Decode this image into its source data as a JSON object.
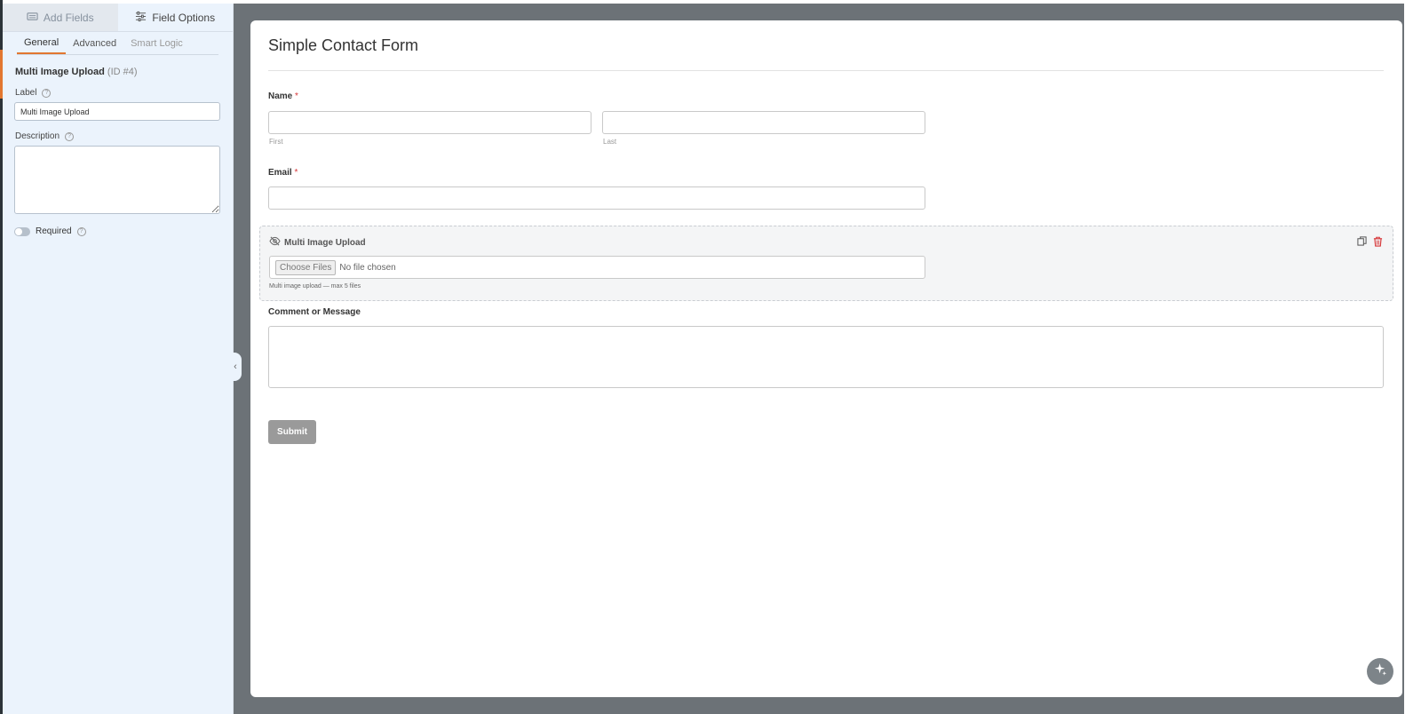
{
  "sidebar": {
    "tabs": [
      {
        "label": "Add Fields",
        "icon": "list-icon"
      },
      {
        "label": "Field Options",
        "icon": "sliders-icon"
      }
    ],
    "sub_tabs": [
      "General",
      "Advanced",
      "Smart Logic"
    ],
    "field_name": "Multi Image Upload",
    "field_id": "(ID #4)",
    "label_caption": "Label",
    "label_value": "Multi Image Upload",
    "description_caption": "Description",
    "description_value": "",
    "required_caption": "Required",
    "required_on": false
  },
  "form": {
    "title": "Simple Contact Form",
    "name_label": "Name",
    "required_mark": "*",
    "first_sublabel": "First",
    "last_sublabel": "Last",
    "email_label": "Email",
    "upload_label": "Multi Image Upload",
    "choose_files": "Choose Files",
    "no_file": "No file chosen",
    "upload_description": "Multi image upload — max 5 files",
    "comment_label": "Comment or Message",
    "submit_label": "Submit"
  },
  "colors": {
    "accent": "#e27730",
    "required": "#d63638",
    "delete": "#d63638"
  }
}
